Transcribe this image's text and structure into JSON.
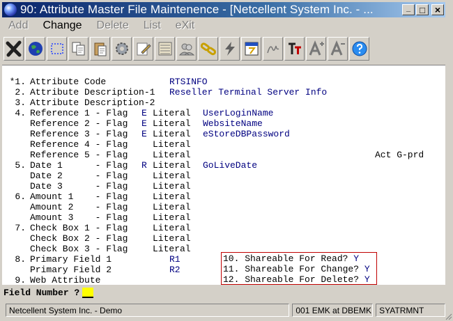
{
  "window": {
    "title": "90: Attribute Master File Maintenence - [Netcellent System Inc. - ...",
    "controls": [
      "_",
      "□",
      "×"
    ]
  },
  "menu": [
    {
      "label": "Add",
      "enabled": false
    },
    {
      "label": "Change",
      "enabled": true
    },
    {
      "label": "Delete",
      "enabled": false
    },
    {
      "label": "List",
      "enabled": false
    },
    {
      "label": "eXit",
      "enabled": false
    }
  ],
  "toolbar": [
    {
      "icon": "exit-x-icon"
    },
    {
      "icon": "globe-icon"
    },
    {
      "icon": "select-rectangle-icon"
    },
    {
      "icon": "copy-icon"
    },
    {
      "icon": "paste-icon"
    },
    {
      "icon": "settings-gear-icon"
    },
    {
      "icon": "edit-pencil-icon"
    },
    {
      "icon": "list-form-icon"
    },
    {
      "icon": "users-icon"
    },
    {
      "icon": "link-chain-icon"
    },
    {
      "icon": "lightning-icon"
    },
    {
      "icon": "calendar-icon"
    },
    {
      "icon": "signature-icon"
    },
    {
      "icon": "font-tt-icon"
    },
    {
      "icon": "increase-font-icon"
    },
    {
      "icon": "decrease-font-icon"
    },
    {
      "icon": "help-icon"
    }
  ],
  "form": {
    "rows": [
      {
        "num": "*1.",
        "label": "Attribute Code",
        "value": "RTSINFO"
      },
      {
        "num": "2.",
        "label": "Attribute Description-1",
        "value": "Reseller Terminal Server Info"
      },
      {
        "num": "3.",
        "label": "Attribute Description-2",
        "value": ""
      },
      {
        "num": "4.",
        "label": "Reference 1 - Flag",
        "flag": "E",
        "lit": "Literal",
        "value": "UserLoginName"
      },
      {
        "num": "",
        "label": "Reference 2 - Flag",
        "flag": "E",
        "lit": "Literal",
        "value": "WebsiteName"
      },
      {
        "num": "",
        "label": "Reference 3 - Flag",
        "flag": "E",
        "lit": "Literal",
        "value": "eStoreDBPassword"
      },
      {
        "num": "",
        "label": "Reference 4 - Flag",
        "flag": "",
        "lit": "Literal",
        "value": ""
      },
      {
        "num": "",
        "label": "Reference 5 - Flag",
        "flag": "",
        "lit": "Literal",
        "value": ""
      },
      {
        "num": "5.",
        "label": "Date 1      - Flag",
        "flag": "R",
        "lit": "Literal",
        "value": "GoLiveDate"
      },
      {
        "num": "",
        "label": "Date 2      - Flag",
        "flag": "",
        "lit": "Literal",
        "value": ""
      },
      {
        "num": "",
        "label": "Date 3      - Flag",
        "flag": "",
        "lit": "Literal",
        "value": ""
      },
      {
        "num": "6.",
        "label": "Amount 1    - Flag",
        "flag": "",
        "lit": "Literal",
        "value": ""
      },
      {
        "num": "",
        "label": "Amount 2    - Flag",
        "flag": "",
        "lit": "Literal",
        "value": ""
      },
      {
        "num": "",
        "label": "Amount 3    - Flag",
        "flag": "",
        "lit": "Literal",
        "value": ""
      },
      {
        "num": "7.",
        "label": "Check Box 1 - Flag",
        "flag": "",
        "lit": "Literal",
        "value": ""
      },
      {
        "num": "",
        "label": "Check Box 2 - Flag",
        "flag": "",
        "lit": "Literal",
        "value": ""
      },
      {
        "num": "",
        "label": "Check Box 3 - Flag",
        "flag": "",
        "lit": "Literal",
        "value": ""
      },
      {
        "num": "8.",
        "label": "Primary Field 1",
        "value": "R1"
      },
      {
        "num": "",
        "label": "Primary Field 2",
        "value": "R2"
      },
      {
        "num": "9.",
        "label": "Web Attribute",
        "value": ""
      }
    ],
    "side_note": "Act G-prd",
    "shareable": [
      {
        "label": "10. Shareable For Read?",
        "value": "Y"
      },
      {
        "label": "11. Shareable For Change?",
        "value": "Y"
      },
      {
        "label": "12. Shareable For Delete?",
        "value": "Y"
      }
    ],
    "prompt": "Field Number ?"
  },
  "status": {
    "company": "Netcellent System Inc. - Demo",
    "user": "001 EMK at DBEMK",
    "program": "SYATRMNT"
  }
}
